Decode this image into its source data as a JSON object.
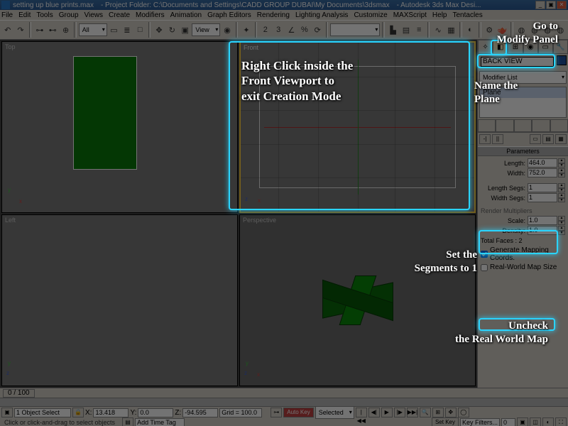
{
  "title": {
    "file": "setting up blue prints.max",
    "project": "- Project Folder: C:\\Documents and Settings\\CADD GROUP DUBAI\\My Documents\\3dsmax",
    "app": "- Autodesk 3ds Max Desi..."
  },
  "window_buttons": {
    "min": "_",
    "max": "▣",
    "close": "✕"
  },
  "menu": [
    "File",
    "Edit",
    "Tools",
    "Group",
    "Views",
    "Create",
    "Modifiers",
    "Animation",
    "Graph Editors",
    "Rendering",
    "Lighting Analysis",
    "Customize",
    "MAXScript",
    "Help",
    "Tentacles"
  ],
  "toolbar": {
    "undo": "↶",
    "redo": "↷",
    "link": "⊶",
    "unlink": "⊷",
    "bind": "⊕",
    "sel_filter": "All",
    "select": "▭",
    "byname": "≣",
    "region": "□",
    "move": "✥",
    "rotate": "↻",
    "scale": "▣",
    "refcoord": "View",
    "center": "◉",
    "manip": "✦",
    "snap2": "2",
    "snap3": "3",
    "angsnap": "∠",
    "pctsnap": "%",
    "spinner": "⟳",
    "named_sel": "",
    "mirror": "▙",
    "align": "▤",
    "layers": "≡",
    "curve": "∿",
    "schematic": "▦",
    "matedit": "◐",
    "render_set": "⚙",
    "render": "🫖",
    "g1": "◍",
    "g2": "◍",
    "g3": "◍",
    "g4": "◍"
  },
  "viewports": {
    "tl": "Top",
    "tr": "Front",
    "bl": "Left",
    "br": "Perspective",
    "axis_x": "x",
    "axis_y": "y",
    "axis_z": "z"
  },
  "panel": {
    "tabs": {
      "create": "✧",
      "modify": "◧",
      "hierarchy": "⊞",
      "motion": "◉",
      "display": "▭",
      "util": "🔧"
    },
    "name": "BACK VIEW",
    "mod_dropdown": "Modifier List",
    "mod_item": "Plane",
    "params_header": "Parameters",
    "length_label": "Length:",
    "length_val": "464.0",
    "width_label": "Width:",
    "width_val": "752.0",
    "lengthsegs_label": "Length Segs:",
    "lengthsegs_val": "1",
    "widthsegs_label": "Width Segs:",
    "widthsegs_val": "1",
    "render_mult_header": "Render Multipliers",
    "scale_label": "Scale:",
    "scale_val": "1.0",
    "density_label": "Density:",
    "density_val": "1.0",
    "totalfaces": "Total Faces : 2",
    "gen_map": "Generate Mapping Coords.",
    "real_world": "Real-World Map Size"
  },
  "bottom": {
    "time": "0 / 100",
    "selcount": "1 Object Select",
    "lock": "🔒",
    "xlabel": "X:",
    "xval": "13.418",
    "ylabel": "Y:",
    "yval": "0.0",
    "zlabel": "Z:",
    "zval": "-94.595",
    "grid": "Grid = 100.0",
    "autokey": "Auto Key",
    "setkey": "Set Key",
    "selected": "Selected",
    "keyfilters": "Key Filters...",
    "play": {
      "start": "|◀◀",
      "prev": "◀|",
      "playb": "▶",
      "next": "|▶",
      "end": "▶▶|"
    },
    "frame": "0",
    "prompt": "Click or click-and-drag to select objects",
    "addtag": "Add Time Tag"
  },
  "callouts": {
    "modify": "Go to\nModify Panel",
    "name": "Name the\nPlane",
    "front": "Right Click inside the\nFront Viewport to\nexit Creation Mode",
    "segs": "Set the\nSegments to 1",
    "rwm": "Uncheck\nthe Real World Map"
  }
}
